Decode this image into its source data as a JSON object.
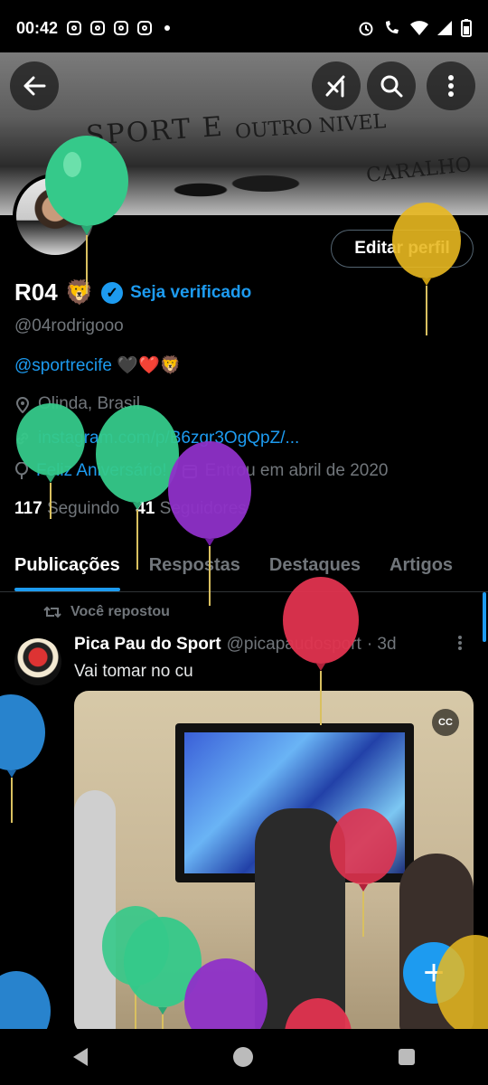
{
  "status_bar": {
    "time": "00:42"
  },
  "header": {
    "edit_profile_label": "Editar perfil"
  },
  "banner": {
    "graffiti_main": "SPORT E",
    "graffiti_second": "OUTRO NIVEL",
    "graffiti_third": "CARALHO"
  },
  "profile": {
    "name": "R04",
    "name_emoji": "🦁",
    "verify_label": "Seja verificado",
    "handle": "@04rodrigooo",
    "bio_mention": "@sportrecife",
    "bio_emojis": "🖤❤️🦁",
    "location": "Olinda, Brasil",
    "link": "instagram.com/p/B6zgr3OgQpZ/...",
    "birthday": "Feliz Aniversário!",
    "joined": "Entrou em abril de 2020",
    "following_count": "117",
    "following_label": "Seguindo",
    "followers_count": "41",
    "followers_label": "Seguidores"
  },
  "tabs": [
    {
      "label": "Publicações",
      "active": true
    },
    {
      "label": "Respostas",
      "active": false
    },
    {
      "label": "Destaques",
      "active": false
    },
    {
      "label": "Artigos",
      "active": false
    }
  ],
  "post": {
    "repost_label": "Você repostou",
    "author": "Pica Pau do Sport",
    "author_handle": "@picapaudosport",
    "time": "· 3d",
    "text": "Vai tomar no cu",
    "cc_label": "CC"
  },
  "colors": {
    "accent": "#1d9bf0",
    "background": "#000000",
    "muted": "#71767b"
  }
}
